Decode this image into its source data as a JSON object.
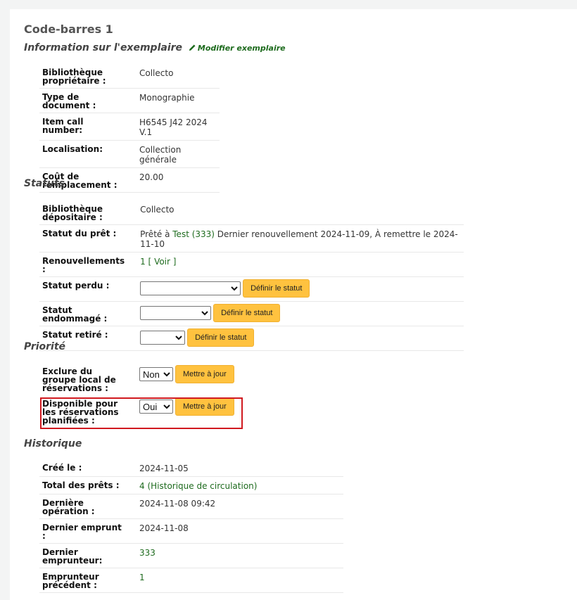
{
  "heading": "Code-barres 1",
  "info": {
    "title": "Information sur l'exemplaire",
    "edit_link": "Modifier exemplaire",
    "rows": [
      {
        "label": "Bibliothèque propriétaire :",
        "value": "Collecto"
      },
      {
        "label": "Type de document :",
        "value": "Monographie"
      },
      {
        "label": "Item call number:",
        "value": "H6545 J42 2024 V.1"
      },
      {
        "label": "Localisation:",
        "value": "Collection générale"
      },
      {
        "label": "Coût de remplacement :",
        "value": "20.00"
      }
    ]
  },
  "statuts": {
    "title": "Statuts",
    "depositaire_label": "Bibliothèque dépositaire :",
    "depositaire_value": "Collecto",
    "pret_label": "Statut du prêt :",
    "pret_prefix": "Prêté à ",
    "pret_link": "Test (333)",
    "pret_suffix": " Dernier renouvellement 2024-11-09, À remettre le 2024-11-10",
    "renouv_label": "Renouvellements :",
    "renouv_count": "1 [ ",
    "renouv_link": "Voir",
    "renouv_close": " ]",
    "perdu_label": "Statut perdu :",
    "endommage_label": "Statut endommagé :",
    "retire_label": "Statut retiré :",
    "set_status_button": "Définir le statut"
  },
  "priorite": {
    "title": "Priorité",
    "exclure_label": "Exclure du groupe local de réservations :",
    "exclure_value": "Non",
    "disponible_label": "Disponible pour les réservations planifiées :",
    "disponible_value": "Oui",
    "update_button": "Mettre à jour"
  },
  "historique": {
    "title": "Historique",
    "cree_label": "Créé le :",
    "cree_value": "2024-11-05",
    "total_label": "Total des prêts :",
    "total_count": "4 ",
    "total_link": "(Historique de circulation)",
    "derniere_op_label": "Dernière opération :",
    "derniere_op_value": "2024-11-08 09:42",
    "dernier_emprunt_label": "Dernier emprunt :",
    "dernier_emprunt_value": "2024-11-08",
    "dernier_emprunteur_label": "Dernier emprunteur:",
    "dernier_emprunteur_value": "333",
    "emprunteur_prec_label": "Emprunteur précédent :",
    "emprunteur_prec_value": "1"
  }
}
